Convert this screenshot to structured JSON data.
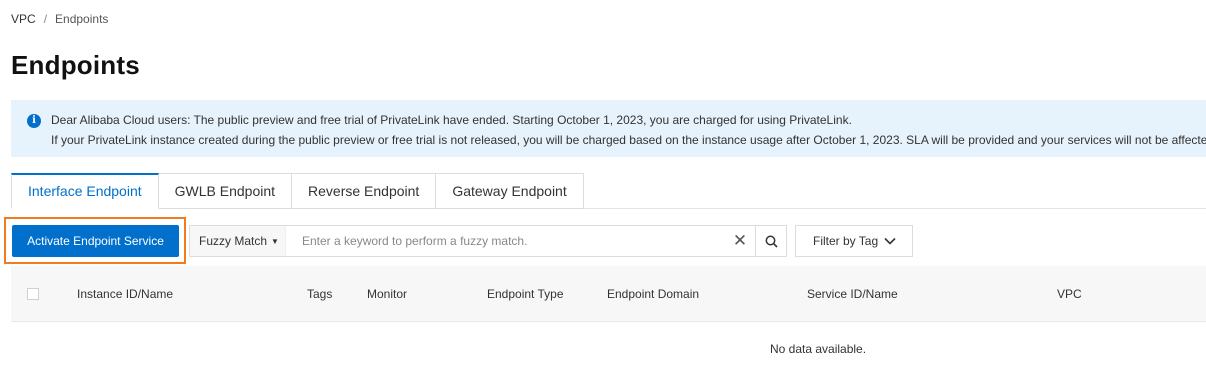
{
  "breadcrumb": {
    "root": "VPC",
    "separator": "/",
    "current": "Endpoints"
  },
  "page_title": "Endpoints",
  "notice": {
    "line1": "Dear Alibaba Cloud users: The public preview and free trial of PrivateLink have ended. Starting October 1, 2023, you are charged for using PrivateLink.",
    "line2": "If your PrivateLink instance created during the public preview or free trial is not released, you will be charged based on the instance usage after October 1, 2023. SLA will be provided and your services will not be affected."
  },
  "tabs": [
    {
      "label": "Interface Endpoint",
      "active": true
    },
    {
      "label": "GWLB Endpoint",
      "active": false
    },
    {
      "label": "Reverse Endpoint",
      "active": false
    },
    {
      "label": "Gateway Endpoint",
      "active": false
    }
  ],
  "toolbar": {
    "activate_label": "Activate Endpoint Service",
    "match_mode": "Fuzzy Match",
    "search_placeholder": "Enter a keyword to perform a fuzzy match.",
    "filter_tag_label": "Filter by Tag"
  },
  "table": {
    "columns": [
      "Instance ID/Name",
      "Tags",
      "Monitor",
      "Endpoint Type",
      "Endpoint Domain",
      "Service ID/Name",
      "VPC"
    ],
    "empty_text": "No data available."
  },
  "colors": {
    "accent": "#0070cc",
    "highlight": "#f07c22",
    "notice_bg": "#e6f2fc"
  }
}
